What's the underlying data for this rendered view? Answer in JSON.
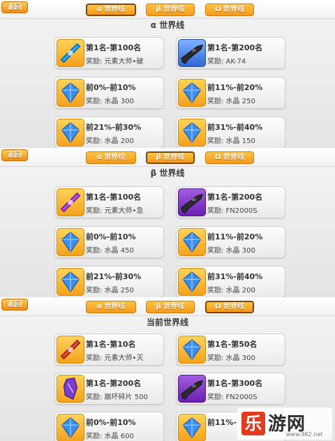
{
  "panels": [
    {
      "back_label": "返回",
      "tabs": [
        {
          "label": "α 世界线",
          "active": true
        },
        {
          "label": "β 世界线",
          "active": false
        },
        {
          "label": "Ω 世界线",
          "active": false
        }
      ],
      "title": "α 世界线",
      "cards": [
        {
          "line1": "第1名-第100名",
          "line2": "奖励: 元素大师•破",
          "icon": "blue-ribbon-icon"
        },
        {
          "line1": "第1名-第200名",
          "line2": "奖励: AK-74",
          "icon": "rifle-icon"
        },
        {
          "line1": "前0%-前10%",
          "line2": "奖励: 水晶 300",
          "icon": "crystal-icon"
        },
        {
          "line1": "前11%-前20%",
          "line2": "奖励: 水晶 250",
          "icon": "crystal-icon"
        },
        {
          "line1": "前21%-前30%",
          "line2": "奖励: 水晶 200",
          "icon": "crystal-icon"
        },
        {
          "line1": "前31%-前40%",
          "line2": "奖励: 水晶 150",
          "icon": "crystal-icon"
        }
      ]
    },
    {
      "back_label": "返回",
      "tabs": [
        {
          "label": "α 世界线",
          "active": false
        },
        {
          "label": "β 世界线",
          "active": true
        },
        {
          "label": "Ω 世界线",
          "active": false
        }
      ],
      "title": "β 世界线",
      "cards": [
        {
          "line1": "第1名-第100名",
          "line2": "奖励: 元素大师•急",
          "icon": "purple-ribbon-icon"
        },
        {
          "line1": "第1名-第200名",
          "line2": "奖励: FN2000S",
          "icon": "rifle-icon"
        },
        {
          "line1": "前0%-前10%",
          "line2": "奖励: 水晶 450",
          "icon": "crystal-icon"
        },
        {
          "line1": "前11%-前20%",
          "line2": "奖励: 水晶 300",
          "icon": "crystal-icon"
        },
        {
          "line1": "前21%-前30%",
          "line2": "奖励: 水晶 250",
          "icon": "crystal-icon"
        },
        {
          "line1": "前31%-前40%",
          "line2": "奖励: 水晶 200",
          "icon": "crystal-icon"
        }
      ]
    },
    {
      "back_label": "返回",
      "tabs": [
        {
          "label": "α 世界线",
          "active": false
        },
        {
          "label": "β 世界线",
          "active": false
        },
        {
          "label": "Ω 世界线",
          "active": true
        }
      ],
      "title": "当前世界线",
      "cards": [
        {
          "line1": "第1名-第10名",
          "line2": "奖励: 元素大师•灭",
          "icon": "red-ribbon-icon"
        },
        {
          "line1": "第1名-第50名",
          "line2": "奖励: 水晶 300",
          "icon": "crystal-icon"
        },
        {
          "line1": "第1名-第200名",
          "line2": "奖励: 崩坏碎片 500",
          "icon": "shard-icon"
        },
        {
          "line1": "第1名-第300名",
          "line2": "奖励: FN2000S",
          "icon": "rifle-icon"
        },
        {
          "line1": "前0%-前10%",
          "line2": "奖励: 水晶 600",
          "icon": "crystal-icon"
        },
        {
          "line1": "前11%-",
          "line2": "",
          "icon": "crystal-icon"
        }
      ]
    }
  ],
  "watermark": {
    "logo": "乐",
    "brand": "游网",
    "url": "www.962.net"
  }
}
